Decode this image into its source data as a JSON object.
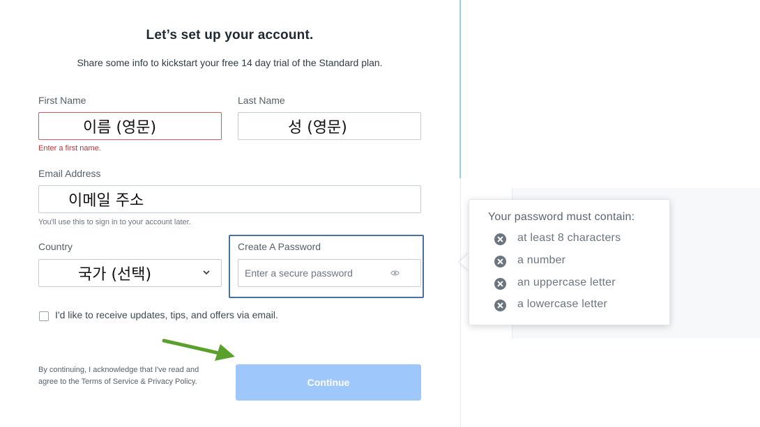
{
  "header": {
    "title": "Let’s set up your account.",
    "subtitle": "Share some info to kickstart your free 14 day trial of the Standard plan."
  },
  "first_name": {
    "label": "First Name",
    "value": "이름 (영문)",
    "error": "Enter a first name."
  },
  "last_name": {
    "label": "Last Name",
    "value": "성 (영문)"
  },
  "email": {
    "label": "Email Address",
    "value": "이메일 주소",
    "hint": "You'll use this to sign in to your account later."
  },
  "country": {
    "label": "Country",
    "value": "국가 (선택)"
  },
  "password": {
    "label": "Create A Password",
    "placeholder": "Enter a secure password",
    "highlight_color": "#4a6fa5"
  },
  "opt_in": {
    "label": "I'd like to receive updates, tips, and offers via email.",
    "checked": false
  },
  "legal": {
    "text": "By continuing, I acknowledge that I've read and agree to the Terms of Service & Privacy Policy."
  },
  "continue_button": {
    "label": "Continue",
    "color": "#9ec8fb"
  },
  "annotation": {
    "arrow_color": "#5aa02c"
  },
  "password_requirements": {
    "title": "Your password must contain:",
    "items": [
      {
        "text": "at least 8 characters",
        "icon": "x-circle-icon"
      },
      {
        "text": "a number",
        "icon": "x-circle-icon"
      },
      {
        "text": "an uppercase letter",
        "icon": "x-circle-icon"
      },
      {
        "text": "a lowercase letter",
        "icon": "x-circle-icon"
      }
    ]
  }
}
